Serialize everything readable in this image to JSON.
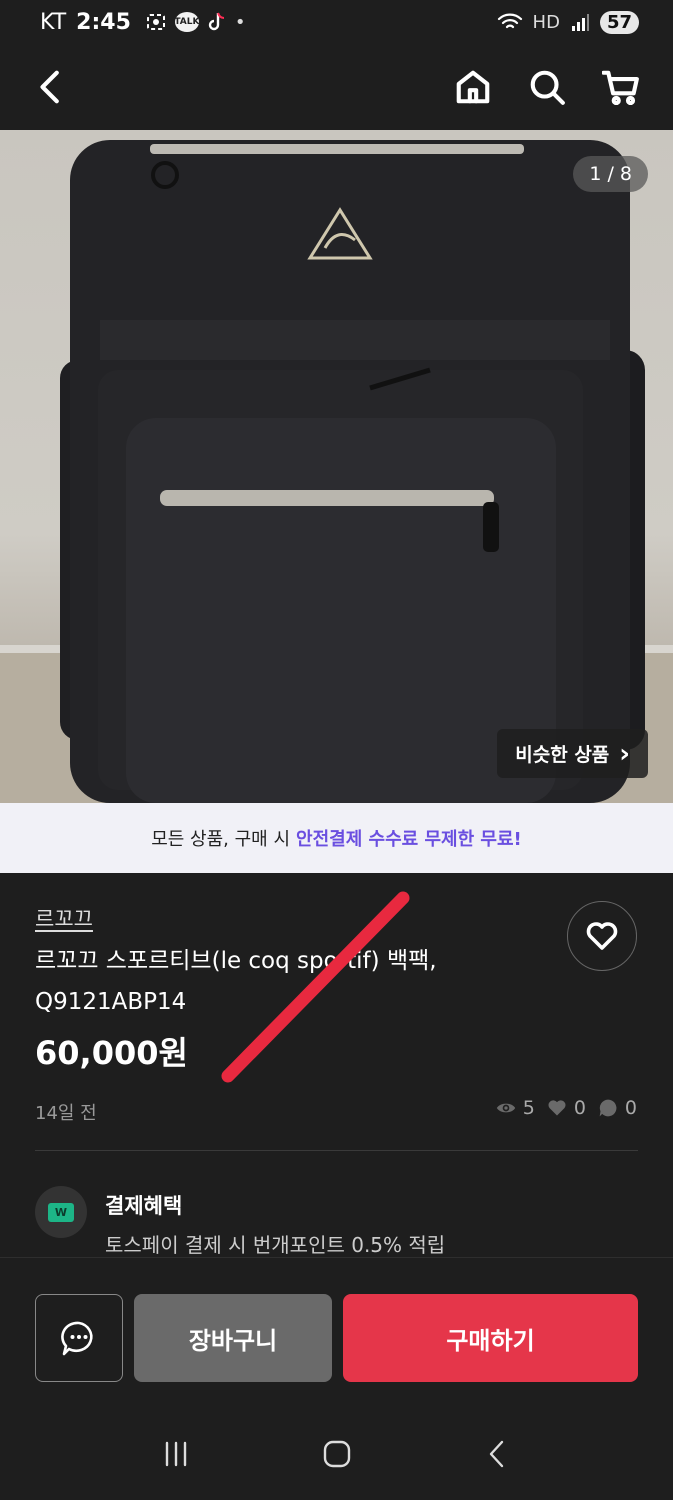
{
  "status_bar": {
    "carrier": "KT",
    "time": "2:45",
    "talk_badge": "TALK",
    "dot": "•",
    "hd_label": "HD",
    "battery": "57"
  },
  "top_nav": {
    "back_icon": "back-arrow-icon",
    "icons": [
      "home-icon",
      "search-icon",
      "cart-icon"
    ]
  },
  "product_image": {
    "counter": "1 / 8",
    "similar_button": "비슷한 상품",
    "similar_chevron": "›",
    "description_icon": "backpack-photo"
  },
  "promo": {
    "text": "모든 상품, 구매 시",
    "highlight": "안전결제 수수료 무제한 무료!",
    "highlight_color": "#6a4fe0"
  },
  "product": {
    "brand": "르꼬끄",
    "title_line1": "르꼬끄 스포르티브(le coq sportif) 백팩,",
    "title_line2": "Q9121ABP14",
    "price": "60,000원",
    "posted": "14일 전",
    "views": "5",
    "likes": "0",
    "chats": "0"
  },
  "benefit": {
    "badge": "W",
    "title": "결제혜택",
    "description": "토스페이 결제 시 번개포인트 0.5% 적립"
  },
  "actions": {
    "cart": "장바구니",
    "buy": "구매하기",
    "buy_color": "#e5364a"
  },
  "system_nav": [
    "recent-apps-icon",
    "home-circle-icon",
    "back-icon"
  ]
}
